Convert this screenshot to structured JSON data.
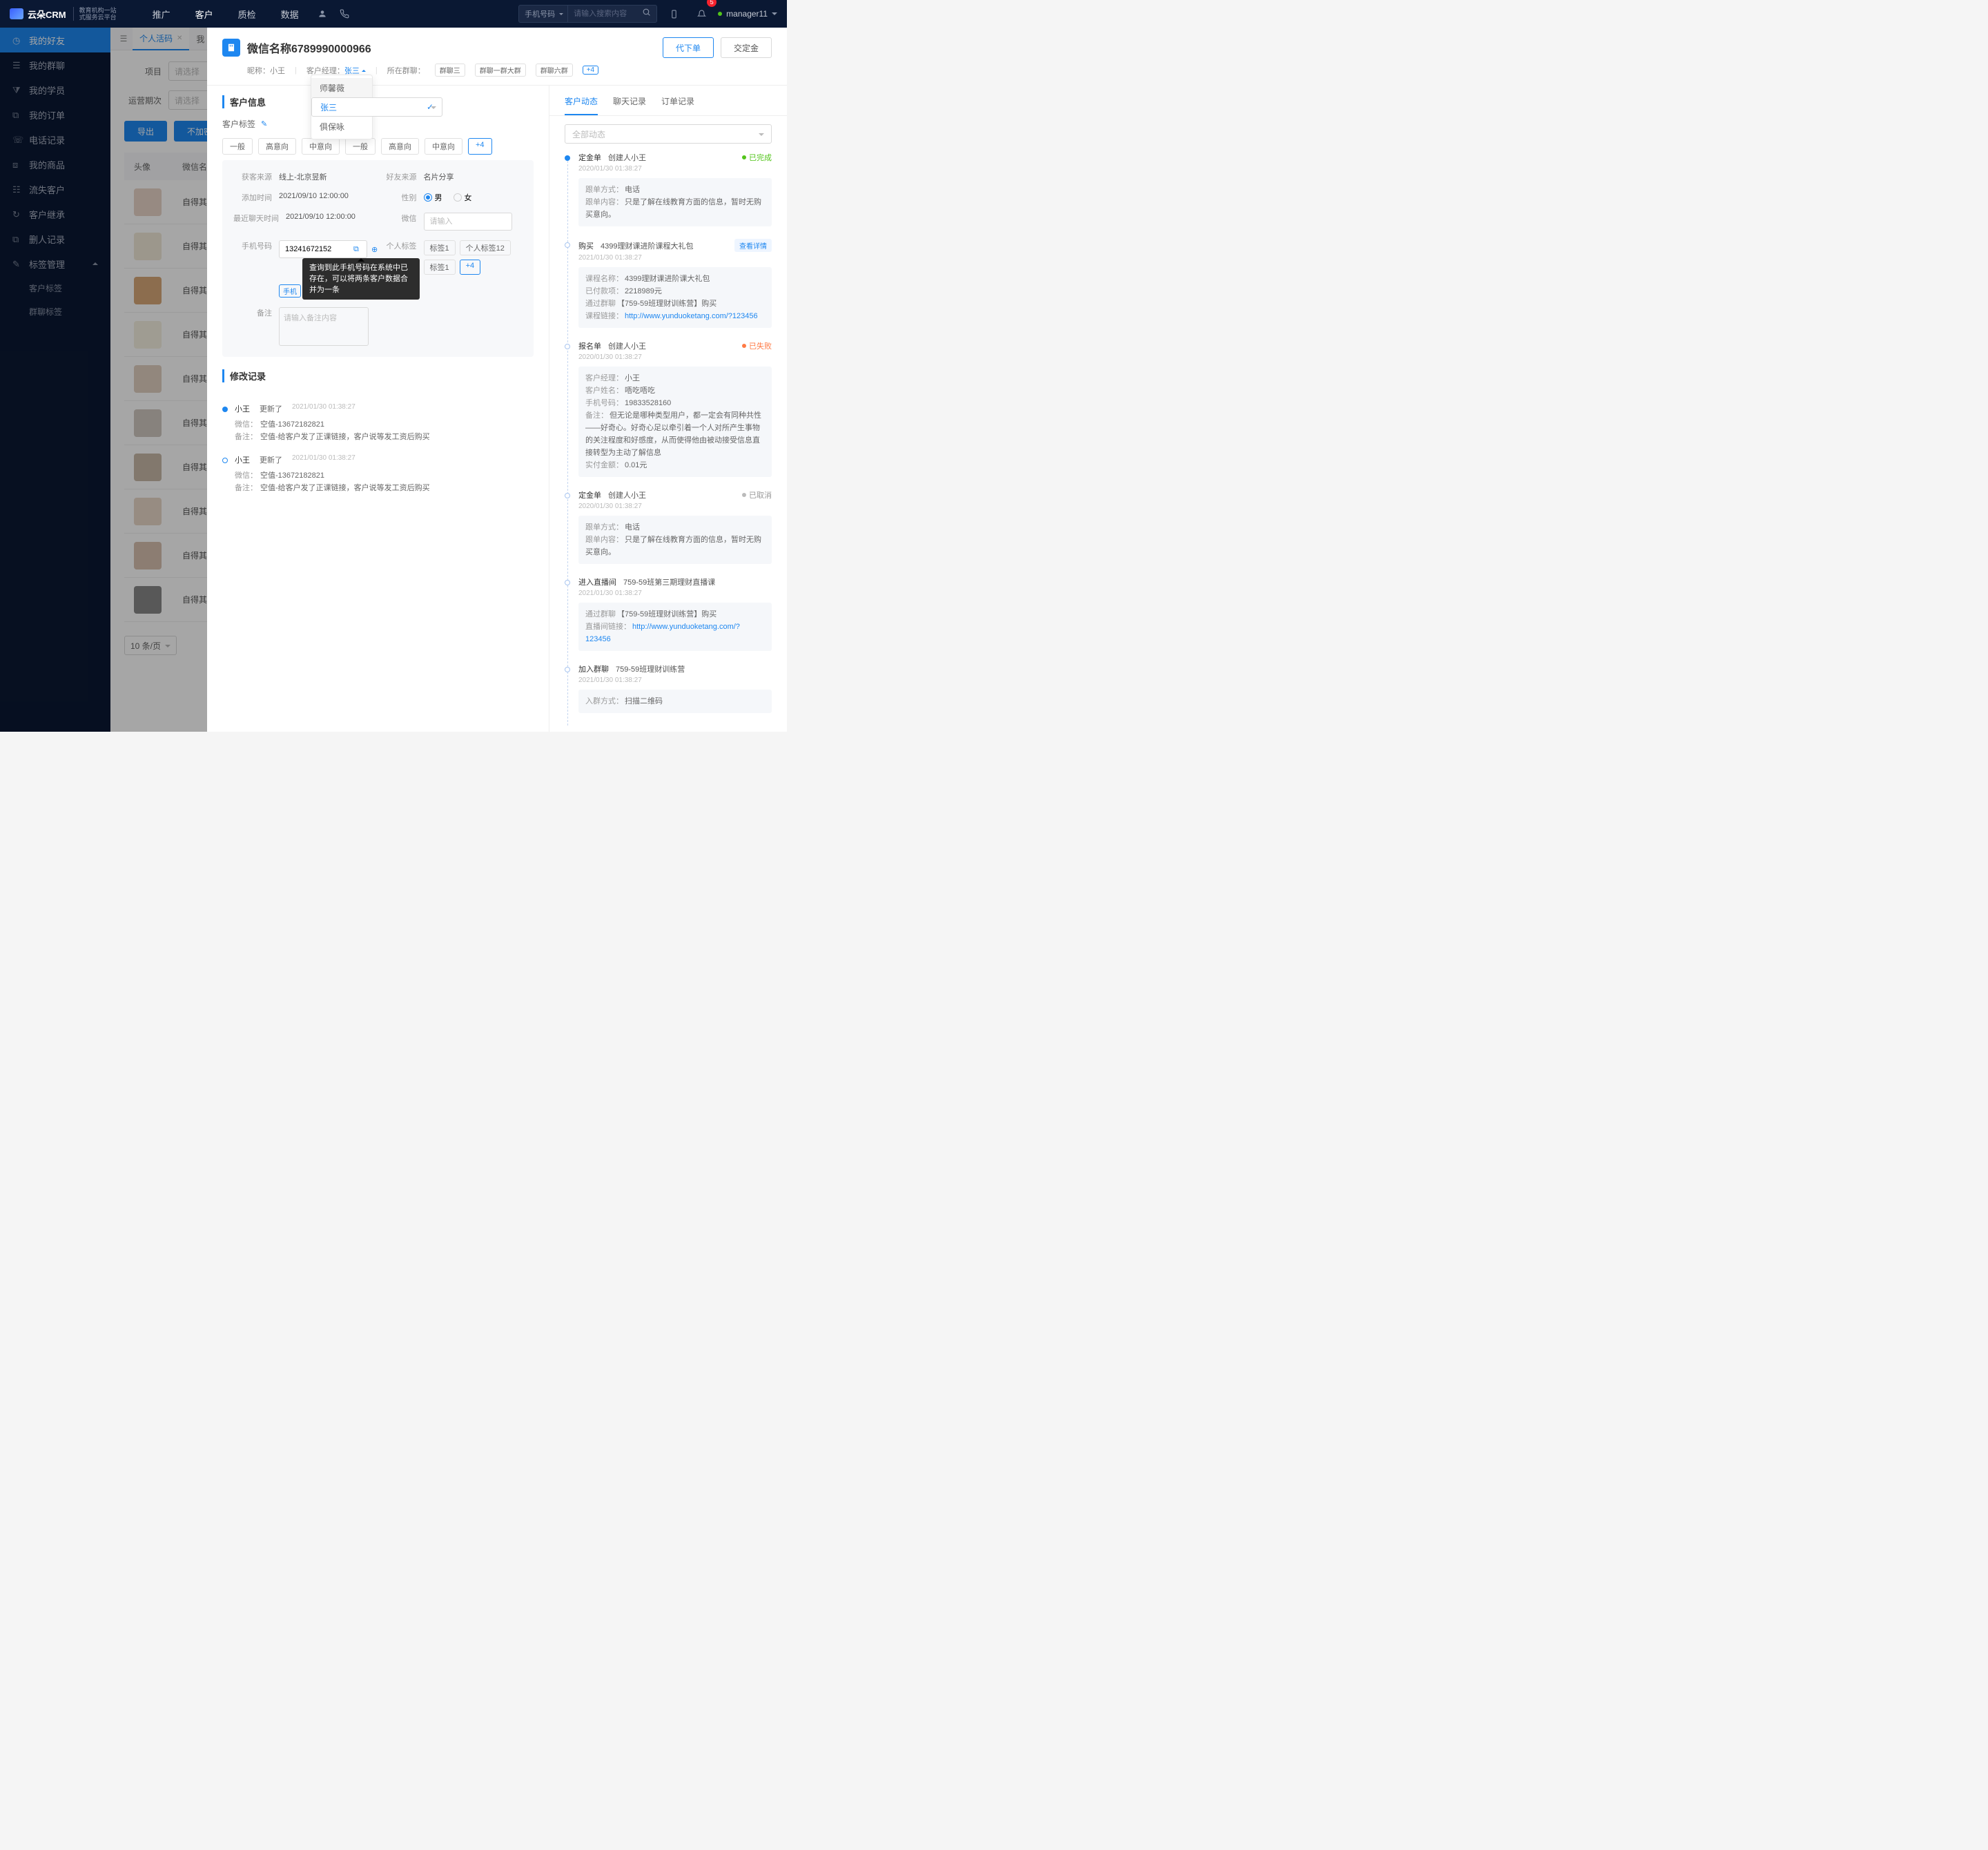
{
  "topbar": {
    "logo_text": "云朵CRM",
    "logo_sub1": "教育机构一站",
    "logo_sub2": "式服务云平台",
    "nav": [
      "推广",
      "客户",
      "质检",
      "数据"
    ],
    "active_nav": 1,
    "search_type": "手机号码",
    "search_placeholder": "请输入搜索内容",
    "badge": "5",
    "user": "manager11"
  },
  "sidebar": {
    "items": [
      "我的好友",
      "我的群聊",
      "我的学员",
      "我的订单",
      "电话记录",
      "我的商品",
      "流失客户",
      "客户继承",
      "删人记录",
      "标签管理"
    ],
    "active": 0,
    "sub": [
      "客户标签",
      "群聊标签"
    ]
  },
  "tabs": {
    "items": [
      "个人活码",
      "我"
    ],
    "active": 0
  },
  "bg": {
    "filter1_label": "项目",
    "filter2_label": "运营期次",
    "select_placeholder": "请选择",
    "btn_export": "导出",
    "btn_noenc": "不加密导出",
    "col1": "头像",
    "col2": "微信名",
    "cell": "自得其",
    "pager": "10 条/页"
  },
  "drawer": {
    "title": "微信名称6789990000966",
    "btn_order": "代下单",
    "btn_deposit": "交定金",
    "nick_lbl": "昵称：",
    "nick": "小王",
    "mgr_lbl": "客户经理：",
    "mgr": "张三",
    "grp_lbl": "所在群聊：",
    "grps": [
      "群聊三",
      "群聊一群大群",
      "群聊六群"
    ],
    "grp_more": "+4"
  },
  "dropdown": {
    "items": [
      "师馨薇",
      "张三",
      "俱保咏"
    ],
    "selected": 1
  },
  "info": {
    "sec_title": "客户信息",
    "tag_lbl": "客户标签",
    "tags": [
      "一般",
      "高意向",
      "中意向",
      "一般",
      "高意向",
      "中意向"
    ],
    "tag_more": "+4",
    "src_lbl": "获客来源",
    "src": "线上-北京昱新",
    "fsrc_lbl": "好友来源",
    "fsrc": "名片分享",
    "add_lbl": "添加时间",
    "add": "2021/09/10 12:00:00",
    "sex_lbl": "性别",
    "male": "男",
    "female": "女",
    "chat_lbl": "最近聊天时间",
    "chat": "2021/09/10 12:00:00",
    "wx_lbl": "微信",
    "wx_ph": "请输入",
    "phone_lbl": "手机号码",
    "phone": "13241672152",
    "phone_pill": "手机",
    "tooltip": "查询到此手机号码在系统中已存在，可以将两条客户数据合并为一条",
    "ptag_lbl": "个人标签",
    "ptags": [
      "标签1",
      "个人标签12",
      "标签1"
    ],
    "ptag_more": "+4",
    "remark_lbl": "备注",
    "remark_ph": "请输入备注内容"
  },
  "hist": {
    "sec_title": "修改记录",
    "items": [
      {
        "who": "小王",
        "act": "更新了",
        "date": "2021/01/30  01:38:27",
        "lines": [
          {
            "k": "微信：",
            "v": "空值-13672182821"
          },
          {
            "k": "备注：",
            "v": "空值-给客户发了正课链接，客户说等发工资后购买"
          }
        ]
      },
      {
        "who": "小王",
        "act": "更新了",
        "date": "2021/01/30  01:38:27",
        "lines": [
          {
            "k": "微信：",
            "v": "空值-13672182821"
          },
          {
            "k": "备注：",
            "v": "空值-给客户发了正课链接，客户说等发工资后购买"
          }
        ]
      }
    ]
  },
  "right": {
    "tabs": [
      "客户动态",
      "聊天记录",
      "订单记录"
    ],
    "active": 0,
    "filter": "全部动态",
    "tl": [
      {
        "dot": "solid",
        "title": "定金单",
        "sub": "创建人小王",
        "status": "已完成",
        "stype": "done",
        "date": "2020/01/30  01:38:27",
        "card": [
          {
            "k": "跟单方式：",
            "v": "电话"
          },
          {
            "k": "跟单内容：",
            "v": "只是了解在线教育方面的信息，暂时无购买意向。"
          }
        ]
      },
      {
        "dot": "hollow",
        "title": "购买",
        "sub": "4399理财课进阶课程大礼包",
        "link": "查看详情",
        "date": "2021/01/30  01:38:27",
        "card": [
          {
            "k": "课程名称：",
            "v": "4399理财课进阶课大礼包"
          },
          {
            "k": "已付款项：",
            "v": "2218989元"
          },
          {
            "k": "通过群聊",
            "v": "【759-59班理财训练营】购买"
          },
          {
            "k": "课程链接：",
            "a": "http://www.yunduoketang.com/?123456"
          }
        ]
      },
      {
        "dot": "hollow",
        "title": "报名单",
        "sub": "创建人小王",
        "status": "已失败",
        "stype": "fail",
        "date": "2020/01/30  01:38:27",
        "card": [
          {
            "k": "客户经理：",
            "v": "小王"
          },
          {
            "k": "客户姓名：",
            "v": "唔吃唔吃"
          },
          {
            "k": "手机号码：",
            "v": "19833528160"
          },
          {
            "k": "备注：",
            "v": "但无论是哪种类型用户，都一定会有同种共性——好奇心。好奇心足以牵引着一个人对所产生事物的关注程度和好感度，从而使得他由被动接受信息直接转型为主动了解信息"
          },
          {
            "k": "实付金额：",
            "v": "0.01元"
          }
        ]
      },
      {
        "dot": "hollow",
        "title": "定金单",
        "sub": "创建人小王",
        "status": "已取消",
        "stype": "cancel",
        "date": "2020/01/30  01:38:27",
        "card": [
          {
            "k": "跟单方式：",
            "v": "电话"
          },
          {
            "k": "跟单内容：",
            "v": "只是了解在线教育方面的信息，暂时无购买意向。"
          }
        ]
      },
      {
        "dot": "hollow",
        "title": "进入直播间",
        "sub": "759-59班第三期理财直播课",
        "date": "2021/01/30  01:38:27",
        "card": [
          {
            "k": "通过群聊",
            "v": "【759-59班理财训练营】购买"
          },
          {
            "k": "直播间链接：",
            "a": "http://www.yunduoketang.com/?123456"
          }
        ]
      },
      {
        "dot": "hollow",
        "title": "加入群聊",
        "sub": "759-59班理财训练营",
        "date": "2021/01/30  01:38:27",
        "card": [
          {
            "k": "入群方式：",
            "v": "扫描二维码"
          }
        ]
      }
    ]
  }
}
